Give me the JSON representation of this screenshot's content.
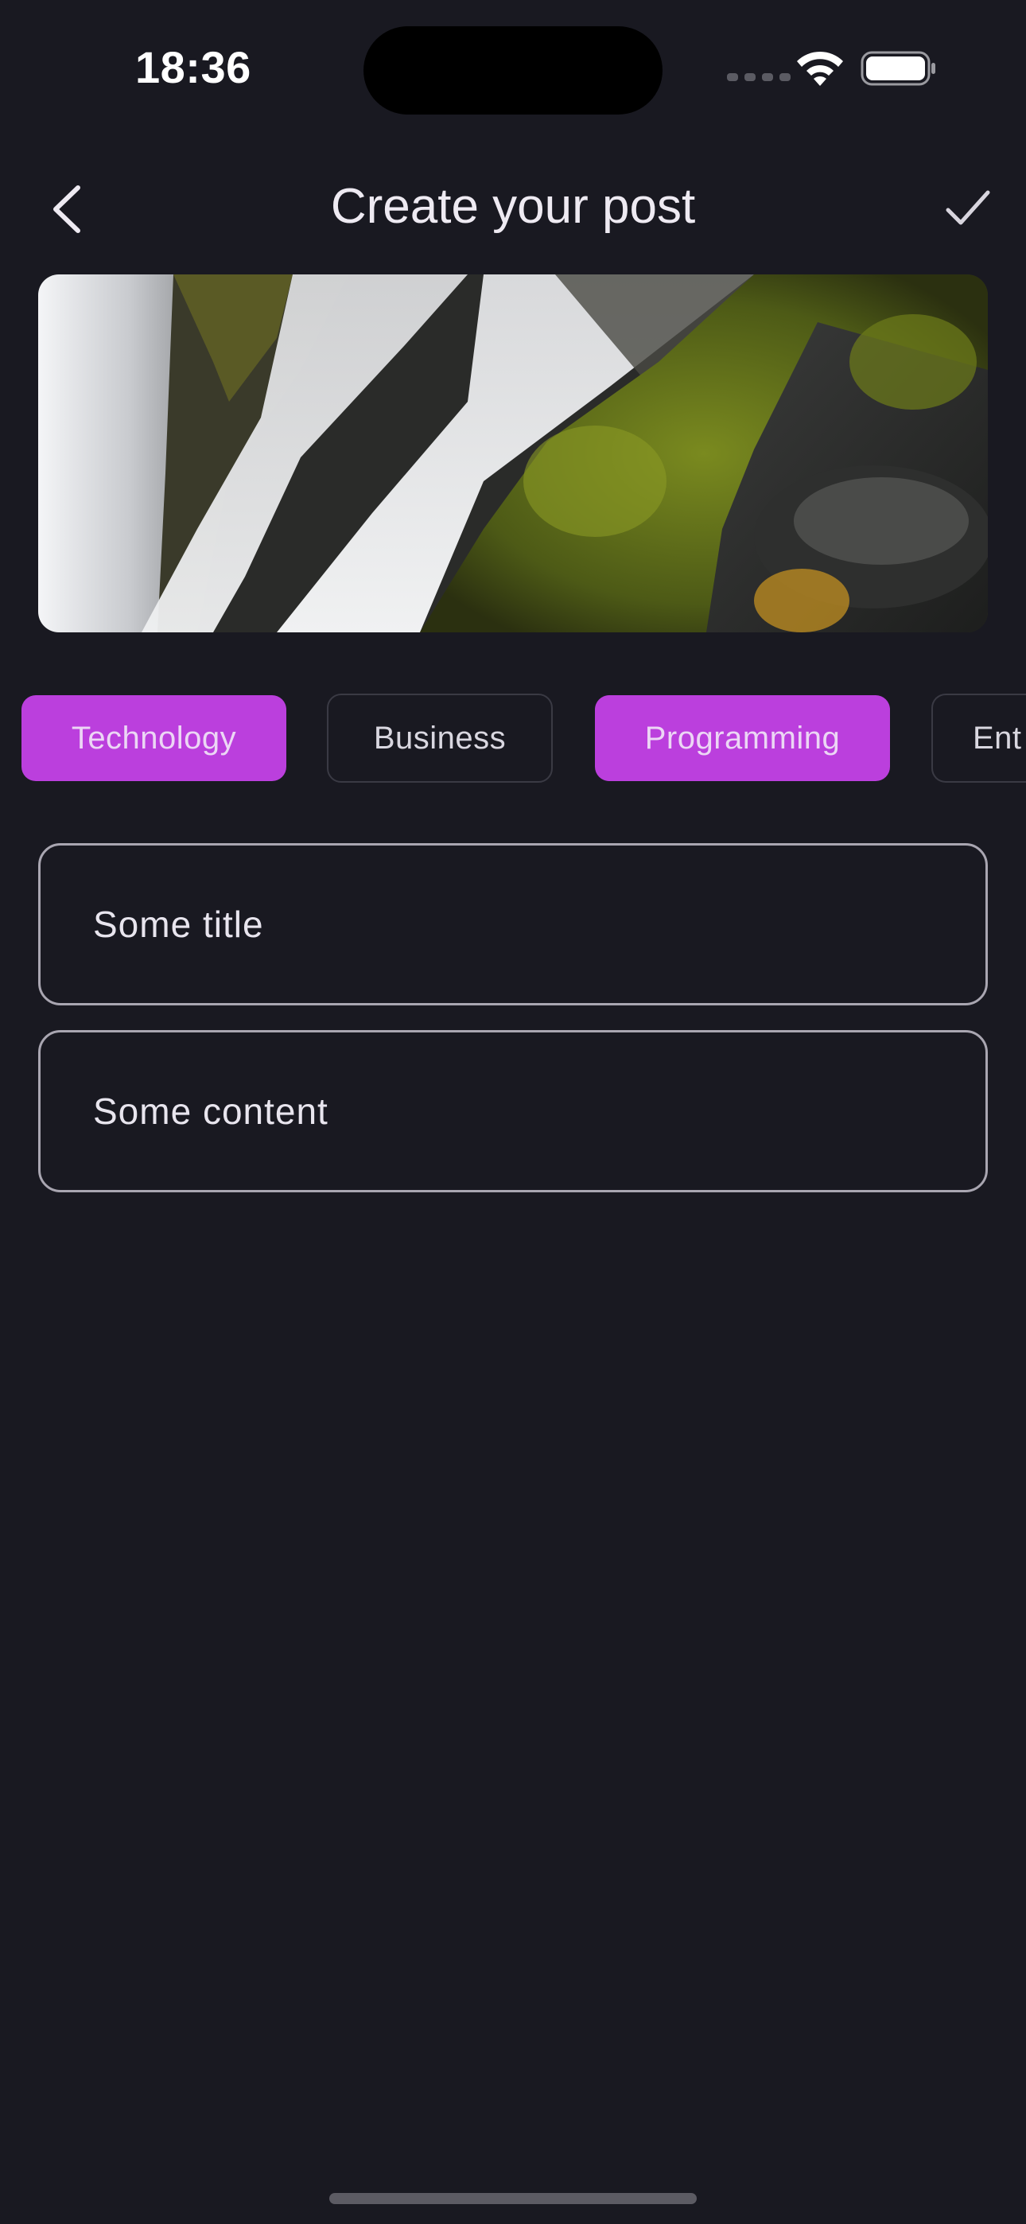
{
  "status_bar": {
    "time": "18:36"
  },
  "header": {
    "title": "Create your post",
    "back_icon": "chevron-left-icon",
    "confirm_icon": "checkmark-icon"
  },
  "categories": [
    {
      "label": "Technology",
      "selected": true
    },
    {
      "label": "Business",
      "selected": false
    },
    {
      "label": "Programming",
      "selected": true
    },
    {
      "label": "Ent",
      "selected": false
    }
  ],
  "form": {
    "title_value": "Some title",
    "content_value": "Some content"
  },
  "colors": {
    "background": "#191921",
    "accent": "#bb3fdd",
    "field_border": "#a9a6b1"
  }
}
